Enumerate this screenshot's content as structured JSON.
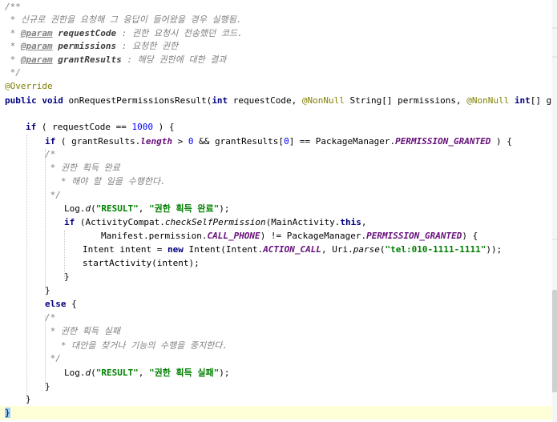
{
  "code": {
    "l1": "/**",
    "l2": " * 신규로 권한을 요청해 그 응답이 들어왔을 경우 실행됨.",
    "l3_pre": " * ",
    "l3_tag": "@param",
    "l3_name": "requestCode",
    "l3_desc": " : 권한 요청시 전송했던 코드.",
    "l4_pre": " * ",
    "l4_tag": "@param",
    "l4_name": "permissions",
    "l4_desc": " : 요청한 권한",
    "l5_pre": " * ",
    "l5_tag": "@param",
    "l5_name": "grantResults",
    "l5_desc": " : 해당 권한에 대한 결과",
    "l6": " */",
    "l7": "@Override",
    "l8_kw1": "public",
    "l8_kw2": "void",
    "l8_a": "onRequestPermissionsResult(",
    "l8_kw3": "int",
    "l8_b": " requestCode, ",
    "l8_ann1": "@NonNull",
    "l8_c": " String[] permissions, ",
    "l8_ann2": "@NonNull",
    "l8_kw4": "int",
    "l8_d": "[] grantResul",
    "l10_kw": "if",
    "l10_a": " ( requestCode == ",
    "l10_num": "1000",
    "l10_b": " ) {",
    "l11_kw": "if",
    "l11_a": " ( grantResults.",
    "l11_fld": "length",
    "l11_b": " > ",
    "l11_num1": "0",
    "l11_c": " && grantResults[",
    "l11_num2": "0",
    "l11_d": "] == PackageManager.",
    "l11_fld2": "PERMISSION_GRANTED",
    "l11_e": " ) {",
    "l12": "/*",
    "l13": " * 권한 획득 완료",
    "l14": "   * 해야 할 일을 수행한다.",
    "l15": " */",
    "l16_a": "Log.",
    "l16_st": "d",
    "l16_b": "(",
    "l16_s1": "\"RESULT\"",
    "l16_c": ", ",
    "l16_s2": "\"권한 획득 완료\"",
    "l16_d": ");",
    "l17_kw": "if",
    "l17_a": " (ActivityCompat.",
    "l17_st": "checkSelfPermission",
    "l17_b": "(MainActivity.",
    "l17_kw2": "this",
    "l17_c": ",",
    "l18_a": "Manifest.permission.",
    "l18_fld": "CALL_PHONE",
    "l18_b": ") != PackageManager.",
    "l18_fld2": "PERMISSION_GRANTED",
    "l18_c": ") {",
    "l19_a": "Intent intent = ",
    "l19_kw": "new",
    "l19_b": " Intent(Intent.",
    "l19_fld": "ACTION_CALL",
    "l19_c": ", Uri.",
    "l19_st": "parse",
    "l19_d": "(",
    "l19_s": "\"tel:010-1111-1111\"",
    "l19_e": "));",
    "l20": "startActivity(intent);",
    "l21": "}",
    "l22": "}",
    "l23_kw": "else",
    "l23_a": " {",
    "l24": "/*",
    "l25": " * 권한 획득 실패",
    "l26": "   * 대안을 찾거나 기능의 수행을 중지한다.",
    "l27": " */",
    "l28_a": "Log.",
    "l28_st": "d",
    "l28_b": "(",
    "l28_s1": "\"RESULT\"",
    "l28_c": ", ",
    "l28_s2": "\"권한 획득 실패\"",
    "l28_d": ");",
    "l29": "}",
    "l30": "}",
    "l31": "}"
  },
  "colors": {
    "background": "#ffffff",
    "comment": "#808080",
    "keyword": "#000080",
    "annotation": "#808000",
    "string": "#008000",
    "number": "#0000ff",
    "constant": "#660e7a",
    "caret_line": "#ffffd7"
  }
}
